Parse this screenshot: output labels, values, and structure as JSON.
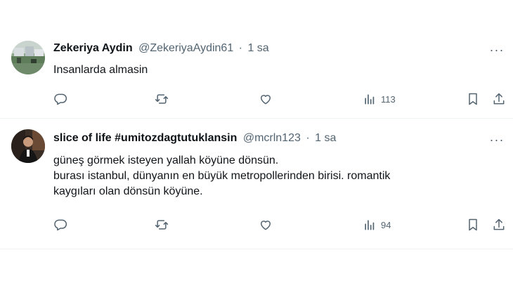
{
  "tweets": [
    {
      "display_name": "Zekeriya Aydin",
      "handle": "@ZekeriyaAydin61",
      "separator": "·",
      "time": "1 sa",
      "more_label": "···",
      "text_lines": [
        "Insanlarda almasin"
      ],
      "stats": {
        "views": "113"
      }
    },
    {
      "display_name": "slice of life #umitozdagtutuklansin",
      "handle": "@mcrln123",
      "separator": "·",
      "time": "1 sa",
      "more_label": "···",
      "text_lines": [
        "güneş görmek isteyen yallah köyüne dönsün.",
        "burası istanbul, dünyanın en büyük metropollerinden birisi. romantik",
        "kaygıları olan dönsün köyüne."
      ],
      "stats": {
        "views": "94"
      }
    }
  ],
  "icons": [
    "reply-icon",
    "retweet-icon",
    "like-icon",
    "views-icon",
    "bookmark-icon",
    "share-icon",
    "more-icon"
  ],
  "colors": {
    "secondary_text": "#536471",
    "primary_text": "#0f1419",
    "divider": "#eff3f4"
  }
}
